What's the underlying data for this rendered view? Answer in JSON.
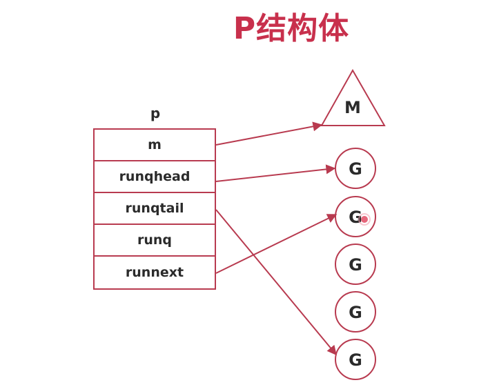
{
  "title": "P结构体",
  "struct": {
    "name": "p",
    "fields": [
      "m",
      "runqhead",
      "runqtail",
      "runq",
      "runnext"
    ]
  },
  "m_node": {
    "label": "M"
  },
  "g_nodes": [
    {
      "label": "G"
    },
    {
      "label": "G"
    },
    {
      "label": "G"
    },
    {
      "label": "G"
    },
    {
      "label": "G"
    }
  ],
  "colors": {
    "title": "#c8304c",
    "stroke": "#b83a4f",
    "text": "#2b2b2b",
    "cursor_dot": "#e0405a"
  }
}
